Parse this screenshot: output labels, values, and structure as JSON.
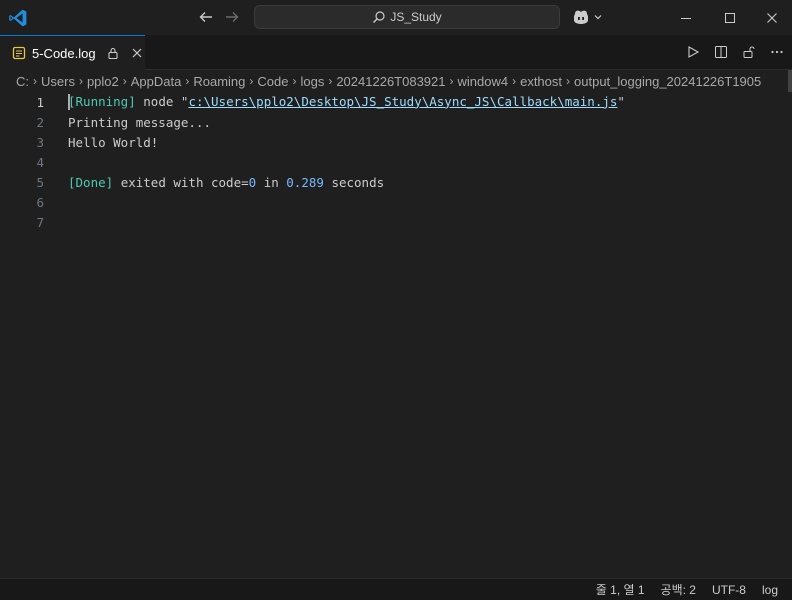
{
  "titlebar": {
    "command_center_text": "JS_Study"
  },
  "tab": {
    "filename": "5-Code.log"
  },
  "breadcrumb": [
    "C:",
    "Users",
    "pplo2",
    "AppData",
    "Roaming",
    "Code",
    "logs",
    "20241226T083921",
    "window4",
    "exthost",
    "output_logging_20241226T1905"
  ],
  "editor": {
    "line_numbers": [
      "1",
      "2",
      "3",
      "4",
      "5",
      "6",
      "7"
    ],
    "lines": [
      {
        "running_open": "[",
        "running_label": "Running",
        "running_close": "]",
        "node_text": " node \"",
        "path": "c:\\Users\\pplo2\\Desktop\\JS_Study\\Async_JS\\Callback\\main.js",
        "quote_close": "\""
      },
      {
        "text": "Printing message..."
      },
      {
        "text": "Hello World!"
      },
      {
        "text": ""
      },
      {
        "done_open": "[",
        "done_label": "Done",
        "done_close": "]",
        "text_a": " exited with code=",
        "code_value": "0",
        "text_b": " in ",
        "seconds_value": "0.289",
        "text_c": " seconds"
      }
    ]
  },
  "statusbar": {
    "position": "줄 1, 열 1",
    "spaces": "공백: 2",
    "encoding": "UTF-8",
    "language": "log"
  }
}
